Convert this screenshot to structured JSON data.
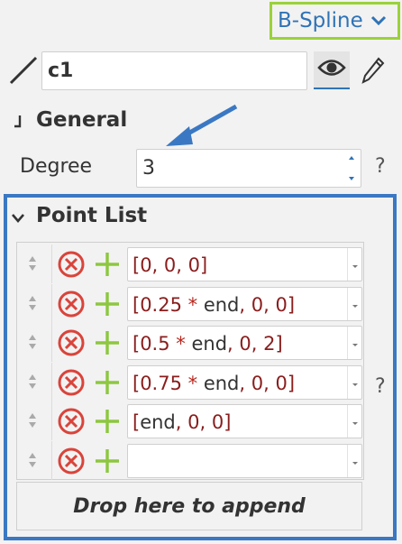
{
  "type_selector": {
    "value": "B-Spline",
    "accent": "#9ad23a",
    "text_color": "#2f73b6"
  },
  "name_row": {
    "name_value": "c1",
    "icons": [
      "line-icon",
      "eye-icon",
      "pencil-icon"
    ]
  },
  "general": {
    "title": "General",
    "degree_label": "Degree",
    "degree_value": "3",
    "help": "?"
  },
  "point_list": {
    "title": "Point List",
    "help": "?",
    "border_color": "#3a78c3",
    "rows": [
      {
        "parts": [
          {
            "t": "[",
            "c": "k"
          },
          {
            "t": "0",
            "c": "k"
          },
          {
            "t": ", ",
            "c": "k"
          },
          {
            "t": "0",
            "c": "k"
          },
          {
            "t": ", ",
            "c": "k"
          },
          {
            "t": "0",
            "c": "k"
          },
          {
            "t": "]",
            "c": "k"
          }
        ],
        "plain": "[0, 0, 0]"
      },
      {
        "parts": [],
        "plain": "[0.25 * end, 0, 0]"
      },
      {
        "parts": [],
        "plain": "[0.5 * end, 0, 2]"
      },
      {
        "parts": [],
        "plain": "[0.75 * end, 0, 0]"
      },
      {
        "parts": [],
        "plain": "[end, 0, 0]"
      },
      {
        "parts": [],
        "plain": ""
      }
    ],
    "drop_label": "Drop here to append"
  },
  "colors": {
    "remove": "#d9443b",
    "add": "#8dc73f",
    "keyword": "#8a1d1d",
    "operator": "#b8281f"
  }
}
